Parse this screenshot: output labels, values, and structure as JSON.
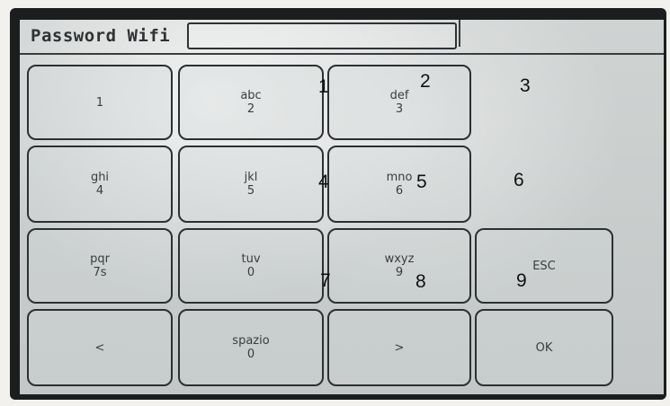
{
  "header": {
    "title": "Password Wifi",
    "password_value": ""
  },
  "keys": [
    {
      "letters": "",
      "digit": "1"
    },
    {
      "letters": "abc",
      "digit": "2"
    },
    {
      "letters": "def",
      "digit": "3"
    },
    {
      "letters": "ghi",
      "digit": "4"
    },
    {
      "letters": "jkl",
      "digit": "5"
    },
    {
      "letters": "mno",
      "digit": "6"
    },
    {
      "letters": "pqr",
      "digit": "7s"
    },
    {
      "letters": "tuv",
      "digit": "0"
    },
    {
      "letters": "wxyz",
      "digit": "9"
    },
    {
      "letters": "ESC",
      "digit": ""
    },
    {
      "letters": "<",
      "digit": ""
    },
    {
      "letters": "spazio",
      "digit": "0"
    },
    {
      "letters": ">",
      "digit": ""
    },
    {
      "letters": "OK",
      "digit": ""
    }
  ],
  "overlay_numbers": [
    "1",
    "2",
    "3",
    "4",
    "5",
    "6",
    "7",
    "8",
    "9"
  ]
}
